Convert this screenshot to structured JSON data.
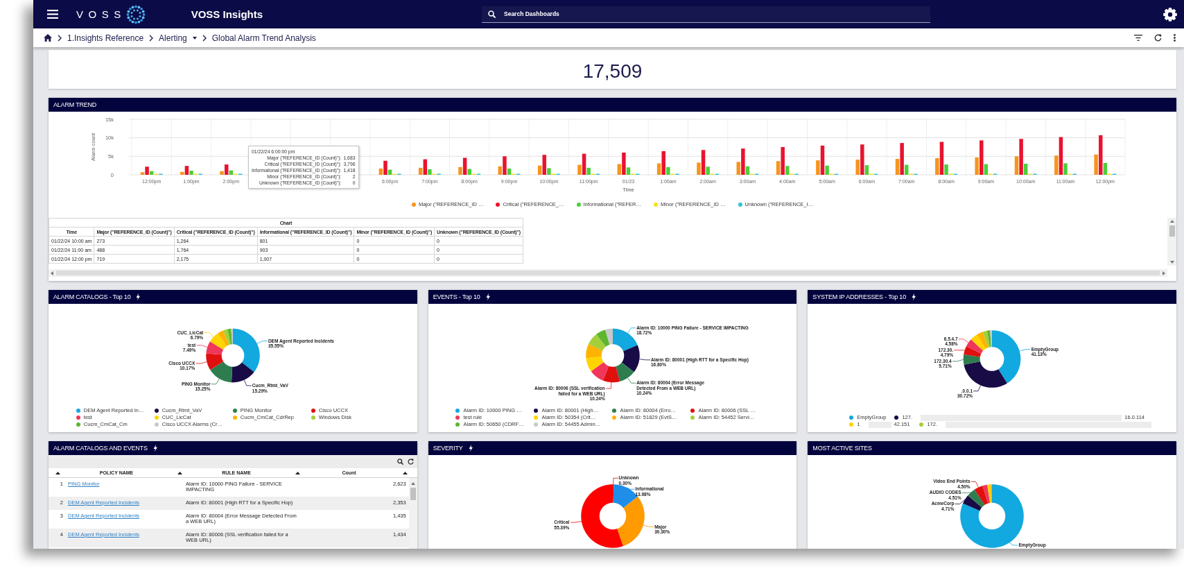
{
  "header": {
    "logo_text": "VOSS",
    "title": "VOSS Insights",
    "search": {
      "placeholder": "Search Dashboards"
    }
  },
  "breadcrumb": [
    {
      "label": "1.Insights Reference",
      "dropdown": false
    },
    {
      "label": "Alerting",
      "dropdown": true
    },
    {
      "label": "Global Alarm Trend Analysis",
      "dropdown": false
    }
  ],
  "total": {
    "value": "17,509"
  },
  "alarm_trend": {
    "title": "ALARM TREND",
    "bolt": false,
    "chart_data": {
      "type": "bar",
      "xlabel": "Time",
      "ylabel": "Alarm count",
      "legend": "bottom",
      "categories": [
        "12:00pm",
        "1:00pm",
        "2:00pm",
        null,
        null,
        null,
        "6:00pm",
        "7:00pm",
        "8:00pm",
        "9:00pm",
        "10:00pm",
        "11:00pm",
        "01/23",
        "1:00am",
        "2:00am",
        "3:00am",
        "4:00am",
        "5:00am",
        "6:00am",
        "7:00am",
        "8:00am",
        "9:00am",
        "10:00am",
        "11:00am",
        "12:00pm"
      ],
      "ylim": [
        0,
        15000
      ],
      "yticks": [
        0,
        {
          "value": 5000,
          "label": "5k"
        },
        {
          "value": 10000,
          "label": "10k"
        },
        {
          "value": 15000,
          "label": "15k"
        }
      ],
      "series": [
        {
          "name": "Major (\"REFERENCE_ID …",
          "color": "#f7941d",
          "values": [
            700,
            800,
            1000,
            null,
            null,
            null,
            1700,
            1900,
            2100,
            2300,
            2500,
            2700,
            2900,
            3100,
            3300,
            3500,
            3700,
            3900,
            4100,
            4300,
            4500,
            4700,
            5000,
            5200,
            5500
          ]
        },
        {
          "name": "Critical (\"REFERENCE_…",
          "color": "#e8132f",
          "values": [
            2200,
            2400,
            2800,
            null,
            null,
            null,
            3800,
            4200,
            4600,
            5000,
            5400,
            5700,
            6000,
            6400,
            6700,
            7100,
            7500,
            7900,
            8200,
            8600,
            8900,
            9300,
            9700,
            10200,
            10700
          ]
        },
        {
          "name": "Informational (\"REFER…",
          "color": "#4ccf3a",
          "values": [
            1000,
            1100,
            1200,
            null,
            null,
            null,
            1400,
            1500,
            1600,
            1700,
            1800,
            1900,
            2000,
            2100,
            2200,
            2300,
            2400,
            2500,
            2600,
            2700,
            2800,
            2900,
            3000,
            3100,
            3200
          ]
        },
        {
          "name": "Minor (\"REFERENCE_ID …",
          "color": "#f4e21c",
          "values": [
            0,
            0,
            0,
            null,
            null,
            null,
            0,
            0,
            0,
            0,
            0,
            0,
            0,
            0,
            0,
            0,
            0,
            0,
            0,
            0,
            0,
            0,
            0,
            0,
            0
          ]
        },
        {
          "name": "Unknown (\"REFERENCE_I…",
          "color": "#2fc3d8",
          "values": [
            0,
            0,
            0,
            null,
            null,
            null,
            0,
            0,
            0,
            0,
            0,
            0,
            0,
            0,
            0,
            0,
            0,
            0,
            0,
            0,
            0,
            0,
            0,
            0,
            0
          ]
        }
      ]
    },
    "tooltip": {
      "title": "01/22/24 6:00:00 pm",
      "rows": [
        {
          "label": "Major (\"REFERENCE_ID (Count)\"):",
          "value": "1,683"
        },
        {
          "label": "Critical (\"REFERENCE_ID (Count)\"):",
          "value": "3,796"
        },
        {
          "label": "Informational (\"REFERENCE_ID (Count)\"):",
          "value": "1,418"
        },
        {
          "label": "Minor (\"REFERENCE_ID (Count)\"):",
          "value": "2"
        },
        {
          "label": "Unknown (\"REFERENCE_ID (Count)\"):",
          "value": "0"
        }
      ]
    },
    "table": {
      "caption": "Chart",
      "columns": [
        "Time",
        "Major (\"REFERENCE_ID (Count)\")",
        "Critical (\"REFERENCE_ID (Count)\")",
        "Informational (\"REFERENCE_ID (Count)\")",
        "Minor (\"REFERENCE_ID (Count)\")",
        "Unknown (\"REFERENCE_ID (Count)\")"
      ],
      "rows": [
        [
          "01/22/24 10:00 am",
          "273",
          "1,264",
          "801",
          "0",
          "0"
        ],
        [
          "01/22/24 11:00 am",
          "488",
          "1,764",
          "903",
          "0",
          "0"
        ],
        [
          "01/22/24 12:00 pm",
          "719",
          "2,175",
          "1,007",
          "0",
          "0"
        ]
      ]
    }
  },
  "panels": [
    {
      "kind": "donut",
      "title": "ALARM CATALOGS - Top 10",
      "bolt": true,
      "chart_data": {
        "type": "donut",
        "legend": "bottom",
        "categories": [
          "DEM Agent Reported In…",
          "Cucm_Rtmt_VaV",
          "PING Monitor",
          "Cisco UCCX",
          "test",
          "CUC_LicCat",
          "Cucm_CmCat_CdrRep",
          "Windows Disk",
          "Cucm_CmCat_Cm",
          "Cisco UCCX Alarms (Cr…"
        ],
        "colors": [
          "#12a8e0",
          "#180b46",
          "#2e7d4f",
          "#e0100f",
          "#f0365a",
          "#ffd400",
          "#ffb300",
          "#a5cf3a",
          "#5db630",
          "#c9c9c9"
        ],
        "values": [
          35.55,
          15.29,
          15.25,
          10.17,
          7.49,
          6.79,
          3.6,
          2.6,
          2.2,
          1.06
        ],
        "value_labels": [
          "DEM Agent Reported Incidents\n35.55%",
          "Cucm_Rtmt_VaV\n15.29%",
          "PING Monitor\n15.25%",
          "Cisco UCCX\n10.17%",
          "test\n7.49%",
          "CUC_LicCat\n6.79%",
          null,
          null,
          null,
          null
        ]
      }
    },
    {
      "kind": "donut",
      "title": "EVENTS - Top 10",
      "bolt": true,
      "chart_data": {
        "type": "donut",
        "legend": "bottom",
        "categories": [
          "Alarm ID: 10000 PING …",
          "Alarm ID: 80001 (High…",
          "Alarm ID: 80004 (Erro…",
          "Alarm ID: 80006 (SSL …",
          "test rule",
          "Alarm ID: 50354 (Crit…",
          "Alarm ID: 51829 (EvtS…",
          "Alarm ID: 54452 Servi…",
          "Alarm ID: 50650 (CDRF…",
          "Alarm ID: 54455 Admin…"
        ],
        "colors": [
          "#12a8e0",
          "#180b46",
          "#2e7d4f",
          "#e0100f",
          "#f0365a",
          "#ffd400",
          "#ffb300",
          "#a5cf3a",
          "#5db630",
          "#c9c9c9"
        ],
        "values": [
          18.72,
          16.8,
          10.24,
          10.24,
          9,
          8.5,
          8.5,
          7.5,
          6,
          4.5
        ],
        "value_labels": [
          "Alarm ID: 10000 PING Failure - SERVICE IMPACTING\n18.72%",
          "Alarm ID: 80001 (High RTT for a Specific Hop)\n16.80%",
          "Alarm ID: 80004 (Error Message\nDetected From a WEB URL)\n10.24%",
          "Alarm ID: 80006 (SSL verification\nfailed for a WEB URL)\n10.24%",
          null,
          null,
          null,
          null,
          null,
          null
        ]
      }
    },
    {
      "kind": "donut",
      "title": "SYSTEM IP ADDRESSES - Top 10",
      "bolt": true,
      "chart_data": {
        "type": "donut",
        "colors": [
          "#12a8e0",
          "#180b46",
          "#2e7d4f",
          "#e0100f",
          "#f0365a",
          "#ffd400",
          "#ffb300",
          "#a5cf3a",
          "#5db630",
          "#c9c9c9"
        ],
        "values": [
          41.13,
          30.72,
          5.71,
          4.79,
          4.58,
          4.3,
          3.5,
          2.5,
          1.7,
          1.07
        ],
        "value_labels": [
          "EmptyGroup\n41.13%",
          ".0.0.1\n30.72%",
          "172.30.4\n5.71%",
          "172.30.\n4.79%",
          "6.5.4.7\n4.58%",
          null,
          null,
          null,
          null,
          null
        ]
      },
      "legend_rows": [
        [
          {
            "kind": "item",
            "label": "EmptyGroup",
            "color": "#12a8e0"
          },
          {
            "kind": "item",
            "label": "127.",
            "color": "#180b46"
          },
          {
            "kind": "redacted"
          },
          {
            "kind": "fragment",
            "label": "16.0.114"
          }
        ],
        [
          {
            "kind": "item",
            "label": "1",
            "color": "#ffd400"
          },
          {
            "kind": "redacted"
          },
          {
            "kind": "fragment",
            "label": "42.151"
          },
          {
            "kind": "item",
            "label": "172.",
            "color": "#a5cf3a"
          },
          {
            "kind": "redacted"
          }
        ]
      ]
    },
    {
      "kind": "table",
      "title": "ALARM CATALOGS AND EVENTS",
      "bolt": true,
      "columns": [
        "POLICY NAME",
        "RULE NAME",
        "Count"
      ],
      "rows": [
        {
          "index": "1",
          "policy": "PING Monitor",
          "rule": "Alarm ID: 10000 PING Failure - SERVICE IMPACTING",
          "count": "2,623"
        },
        {
          "index": "2",
          "policy": "DEM Agent Reported Incidents",
          "rule": "Alarm ID: 80001 (High RTT for a Specific Hop)",
          "count": "2,353"
        },
        {
          "index": "3",
          "policy": "DEM Agent Reported Incidents",
          "rule": "Alarm ID: 80004 (Error Message Detected From a WEB URL)",
          "count": "1,435"
        },
        {
          "index": "4",
          "policy": "DEM Agent Reported Incidents",
          "rule": "Alarm ID: 80006 (SSL verification failed for a WEB URL)",
          "count": "1,434"
        }
      ]
    },
    {
      "kind": "donut",
      "title": "SEVERITY",
      "bolt": true,
      "chart_data": {
        "type": "donut",
        "colors": [
          "#b71c1c",
          "#1e8ee8",
          "#ff9a00",
          "#ff0000"
        ],
        "values": [
          0.3,
          13.98,
          30.3,
          55.39
        ],
        "value_labels": [
          "Unknown\n0.30%",
          "Informational\n13.98%",
          "Major\n30.30%",
          "Critical\n55.39%"
        ]
      }
    },
    {
      "kind": "donut",
      "title": "MOST ACTIVE SITES",
      "bolt": false,
      "chart_data": {
        "type": "donut",
        "colors": [
          "#12a8e0",
          "#180b46",
          "#2e7d4f",
          "#e0100f",
          "#f0365a",
          "#ffd400",
          "#ffb300"
        ],
        "values": [
          81.5,
          4.71,
          4.51,
          4.5,
          2.4,
          1.5,
          0.88
        ],
        "value_labels": [
          "EmptyGroup",
          "AcmeCorp\n4.71%",
          "AUDIO CODES\n4.51%",
          "Video End Points\n4.50%",
          null,
          null,
          null
        ]
      }
    }
  ]
}
